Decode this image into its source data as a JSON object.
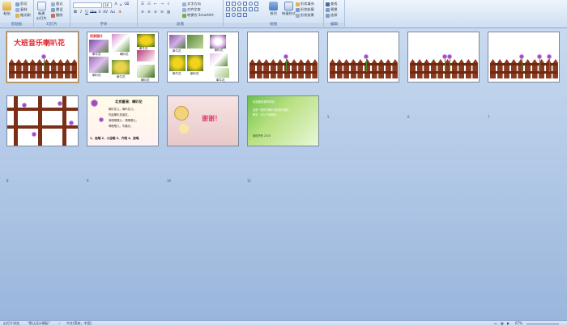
{
  "ribbon": {
    "clipboard": {
      "label": "剪贴板",
      "paste": "粘贴",
      "cut": "剪切",
      "copy": "复制",
      "format_painter": "格式刷"
    },
    "slides": {
      "label": "幻灯片",
      "new_slide": "新建\n幻灯片",
      "layout": "版式",
      "reset": "重设",
      "delete": "删除"
    },
    "font": {
      "label": "字体",
      "font_name": "",
      "font_size": "28"
    },
    "paragraph": {
      "label": "段落",
      "text_direction": "文字方向",
      "align_text": "对齐文本",
      "convert_smartart": "转换为 SmartArt"
    },
    "drawing": {
      "label": "绘图",
      "arrange": "排列",
      "quick_styles": "快速样式",
      "shape_fill": "形状填充",
      "shape_outline": "形状轮廓",
      "shape_effects": "形状效果"
    },
    "editing": {
      "label": "编辑",
      "find": "查找",
      "replace": "替换",
      "select": "选择"
    }
  },
  "slides": [
    {
      "num": "1",
      "title": "大班音乐喇叭花"
    },
    {
      "num": "2",
      "header": "欣赏图片",
      "captions": [
        "牵牛花",
        "喇叭花",
        "牵牛花",
        "喇叭花",
        "牵牛花",
        "喇叭花"
      ]
    },
    {
      "num": "3",
      "captions": [
        "牵牛花",
        "喇叭花",
        "牵牛花",
        "喇叭花",
        "牵牛花"
      ]
    },
    {
      "num": "4"
    },
    {
      "num": "5"
    },
    {
      "num": "6"
    },
    {
      "num": "7"
    },
    {
      "num": "8"
    },
    {
      "num": "9",
      "title": "北京童谣：喇叭花",
      "lines": [
        "喇叭花儿，喇叭花儿，",
        "吹起喇叭找朋友，",
        "滴嗒嗒嗒儿，嗒嗒嗒儿，",
        "嘀嗒嗒儿，吹奏长。"
      ],
      "footer": "1、独唱 2、小组唱 3、齐唱 4、接唱"
    },
    {
      "num": "10",
      "thanks": "谢谢！"
    },
    {
      "num": "11",
      "header": "欢迎使用课件网站",
      "lines": [
        "这是一套有关喇叭花的音乐课件",
        "教学，可以下载使用",
        "版权所有 2024"
      ]
    }
  ],
  "status": {
    "slide_view": "幻灯片浏览",
    "theme": "\"默认设计模板\"",
    "language": "中文(简体，中国)",
    "zoom": "67%"
  }
}
